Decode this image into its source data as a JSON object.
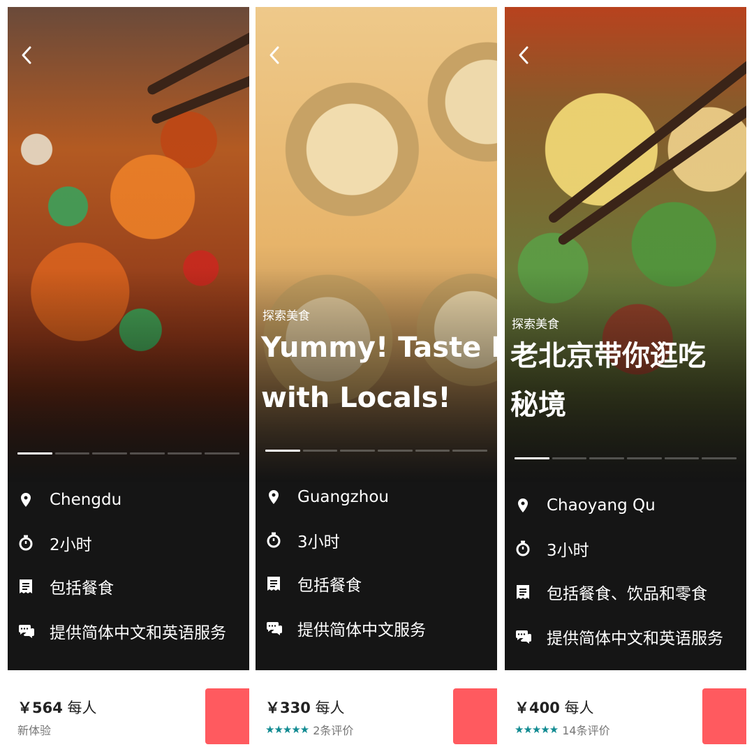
{
  "accent": "#ff5a5f",
  "rating_color": "#108a91",
  "panels": [
    {
      "city": "Chengdu",
      "duration": "2小时",
      "food": "包括餐食",
      "language": "提供简体中文和英语服务",
      "price": "￥564",
      "per_person": "每人",
      "sub_label": "新体验",
      "progress_index": 0
    },
    {
      "category": "探索美食",
      "title_line1": "Yummy! Taste D",
      "title_line2": "with Locals!",
      "city": "Guangzhou",
      "duration": "3小时",
      "food": "包括餐食",
      "language": "提供简体中文服务",
      "price": "￥330",
      "per_person": "每人",
      "stars": "★★★★★",
      "reviews": "2条评价",
      "progress_index": 0
    },
    {
      "category": "探索美食",
      "title_line1": "老北京带你逛吃",
      "title_line2": "秘境",
      "city": "Chaoyang Qu",
      "duration": "3小时",
      "food": "包括餐食、饮品和零食",
      "language": "提供简体中文和英语服务",
      "price": "￥400",
      "per_person": "每人",
      "stars": "★★★★★",
      "reviews": "14条评价",
      "progress_index": 0
    }
  ]
}
